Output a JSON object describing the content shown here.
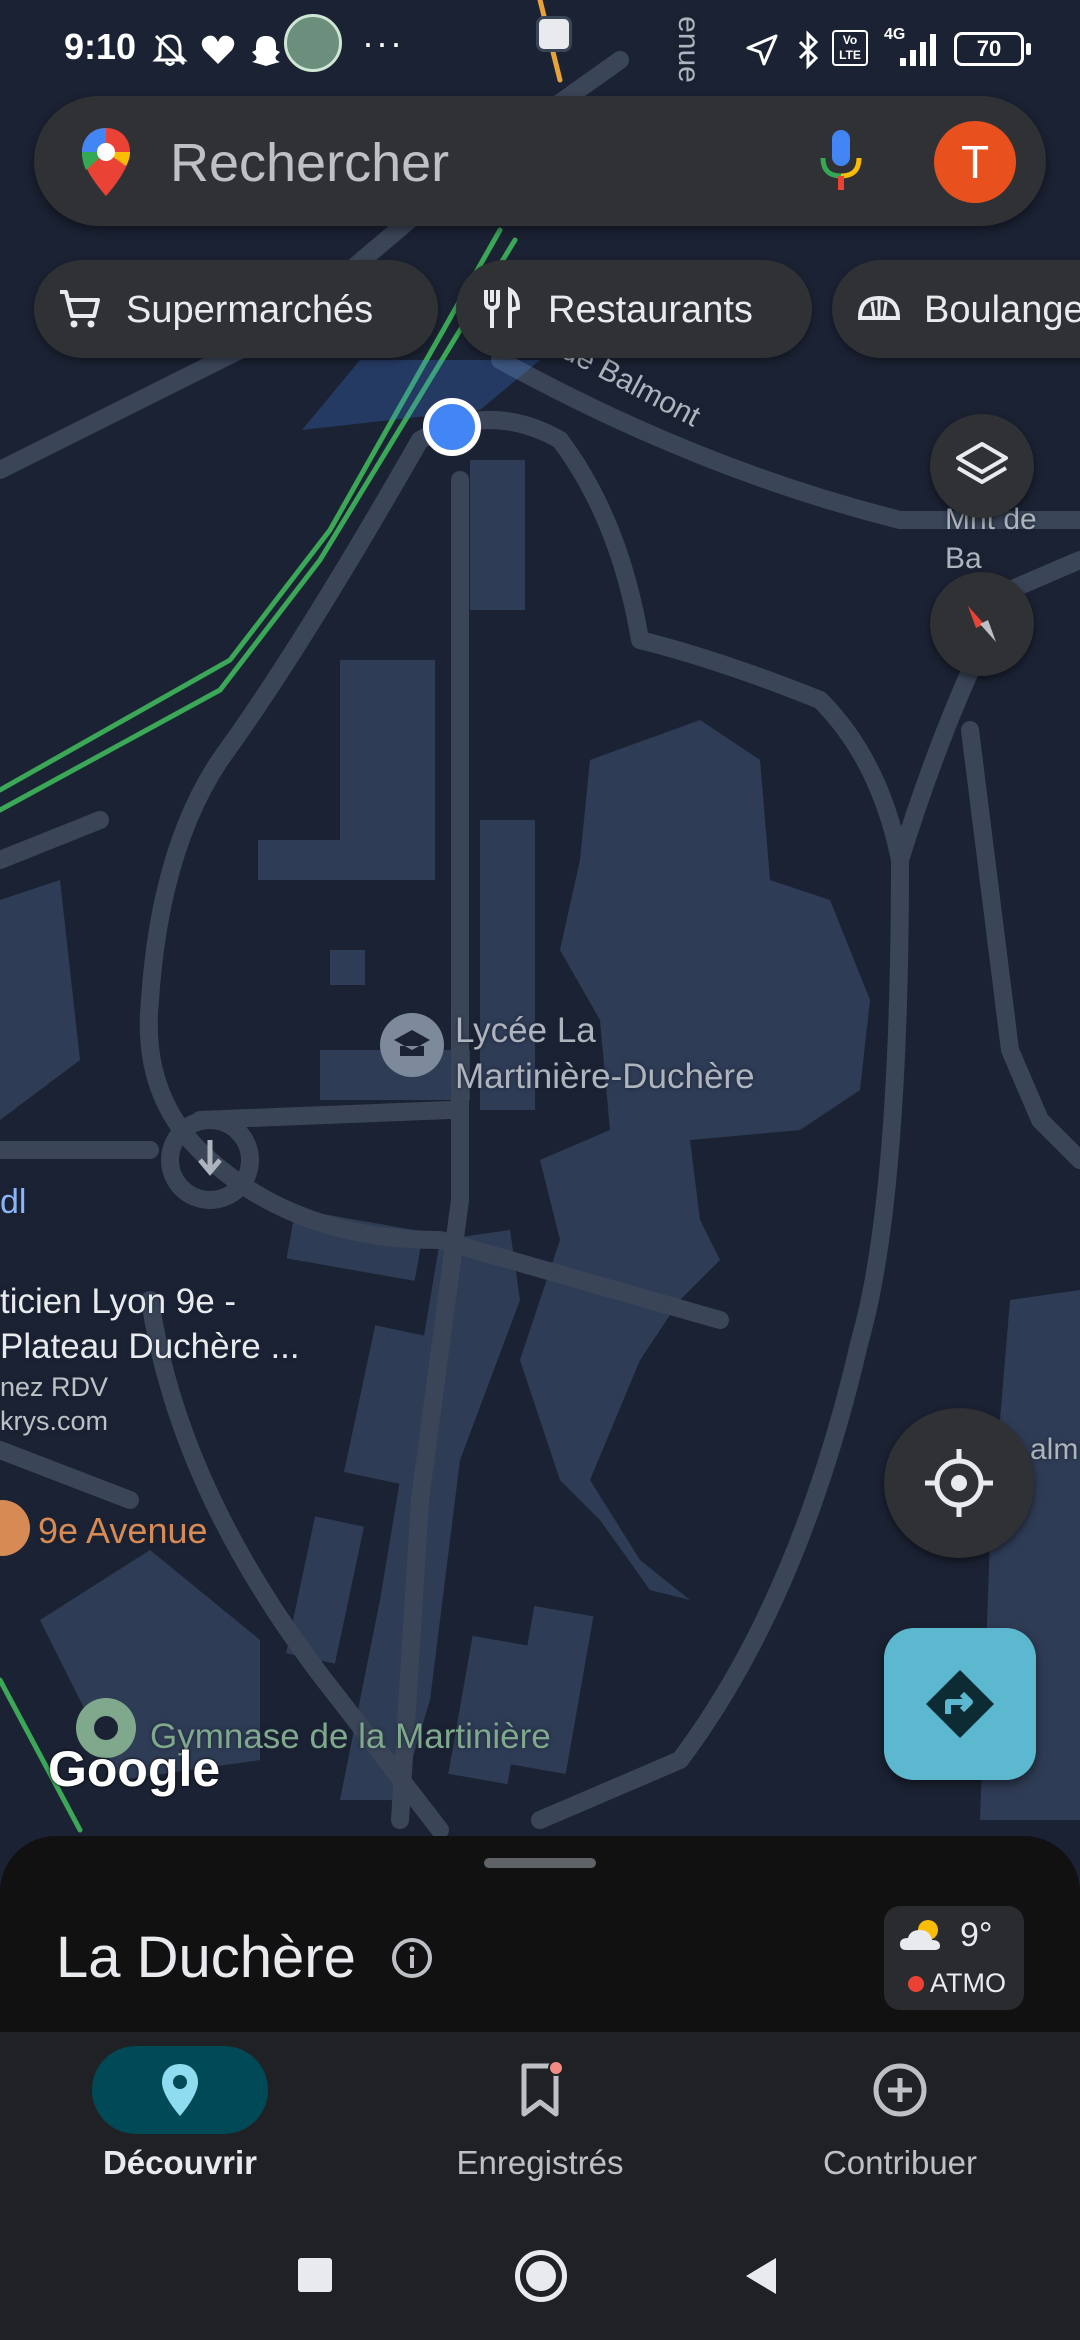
{
  "status_bar": {
    "time": "9:10",
    "battery": "70",
    "network": "4G",
    "volte": "Vo LTE"
  },
  "search": {
    "placeholder": "Rechercher",
    "avatar_initial": "T"
  },
  "chips": [
    {
      "label": "Supermarchés",
      "icon": "cart-icon"
    },
    {
      "label": "Restaurants",
      "icon": "fork-knife-icon"
    },
    {
      "label": "Boulange",
      "icon": "bread-icon"
    }
  ],
  "map": {
    "street_label": "Mnt de Balmont",
    "street_label_right": "Mnt de Ba",
    "avenue_label": "enue",
    "poi_lycee": "Lycée La\nMartinière-Duchère",
    "poi_lycee_line1": "Lycée La",
    "poi_lycee_line2": "Martinière-Duchère",
    "poi_dl": "dl",
    "poi_krys_line1": "ticien Lyon 9e -",
    "poi_krys_line2": "Plateau Duchère ...",
    "poi_krys_line3": "nez RDV",
    "poi_krys_line4": "krys.com",
    "poi_9e_avenue": "9e Avenue",
    "poi_gymnase": "Gymnase de la Martinière",
    "poi_balm": "alm",
    "google_logo": "Google"
  },
  "sheet": {
    "place_name": "La Duchère",
    "weather_temp": "9°",
    "weather_aqi": "ATMO"
  },
  "nav": {
    "items": [
      {
        "label": "Découvrir",
        "icon": "location-pin-icon",
        "active": true
      },
      {
        "label": "Enregistrés",
        "icon": "bookmark-icon",
        "active": false
      },
      {
        "label": "Contribuer",
        "icon": "add-circle-icon",
        "active": false
      }
    ]
  },
  "colors": {
    "map_bg": "#1b2233",
    "road": "#3a4658",
    "building": "#2f3c56",
    "accent_blue": "#4285f4",
    "directions_fab": "#5bb8cf",
    "avatar": "#e8501e",
    "nav_active_pill": "#004a57"
  }
}
